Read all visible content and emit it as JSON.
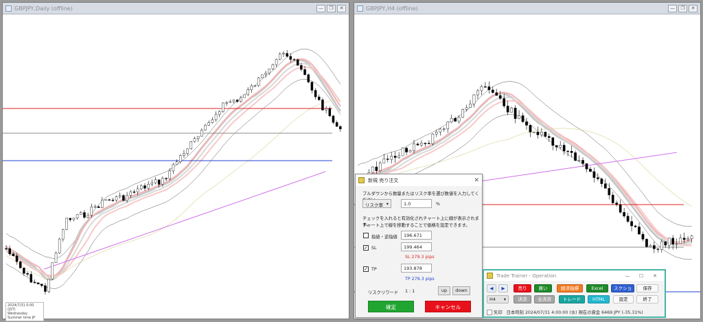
{
  "left_window": {
    "title": "GBPJPY,Daily (offline)",
    "info_lines": [
      "2024/7/31 0:00 (JST)",
      "Wednesday",
      "Summer time  JP"
    ]
  },
  "right_window": {
    "title": "GBPJPY,H4 (offline)"
  },
  "window_controls": {
    "minimize": "—",
    "restore": "❐",
    "close": "✕"
  },
  "order_dialog": {
    "title": "新規 売り注文",
    "instruction": "プルダウンから数量またはリスク率を選び数値を入力してください。",
    "mode_select": "リスク率",
    "mode_value": "1.0",
    "mode_unit": "%",
    "note1": "チェックを入れると有効化されチャート上に線が表示されます。",
    "note2": "チャート上で線を移動することで価格を設定できます。",
    "limit_label": "指値・逆指値",
    "limit_value": "196.671",
    "sl_label": "SL",
    "sl_value": "199.464",
    "sl_pips": "SL 279.3 pips",
    "tp_label": "TP",
    "tp_value": "193.878",
    "tp_pips": "TP 279.3 pips",
    "rr_label": "リスクリワード",
    "rr_value": "1 : 1",
    "up_label": "up",
    "down_label": "down",
    "confirm_label": "確定",
    "cancel_label": "キャンセル",
    "close_icon": "✕"
  },
  "trade_trainer": {
    "title": "Trade Trainer - Operation",
    "controls": {
      "minimize": "—",
      "restore": "☐",
      "close": "✕"
    },
    "prev": "◀",
    "next": "▶",
    "sell": "売り",
    "buy": "買い",
    "indicators": "経済指標",
    "excel": "Excel",
    "screenshot": "スクショ",
    "save": "保存",
    "timeframe": "H4",
    "settle": "決済",
    "settle_all": "全決済",
    "trade": "トレード",
    "html": "HTML",
    "settings": "設定",
    "exit": "終了",
    "status_arrow_label": "矢印",
    "status_text": "日本時刻 2024/07/31 4:00:00 (水)   現在の資金 6469 JPY (-35.31%)"
  },
  "colors": {
    "bull": "#ffffff",
    "bear": "#000000",
    "sl": "#e02020",
    "tp": "#2040d0"
  }
}
